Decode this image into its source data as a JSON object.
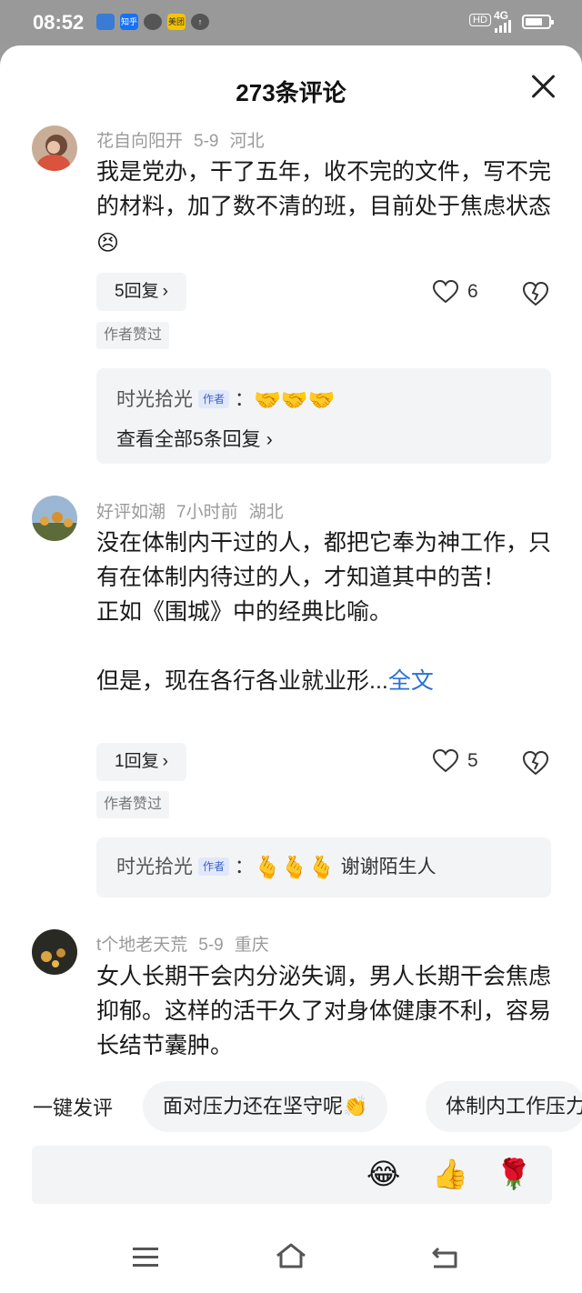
{
  "status_bar": {
    "time": "08:52",
    "apps": [
      {
        "label": "",
        "color": "#3a7bd5",
        "icon": "app-icon-1"
      },
      {
        "label": "知乎",
        "color": "#1772f6",
        "icon": "zhihu-icon"
      },
      {
        "label": "",
        "color": "#555555",
        "icon": "app-icon-3"
      },
      {
        "label": "美团",
        "color": "#f5c400",
        "icon": "meituan-icon"
      },
      {
        "label": "↑",
        "color": "#555555",
        "icon": "upload-icon"
      }
    ],
    "hd": "HD",
    "network": "4G"
  },
  "sheet": {
    "title": "273条评论"
  },
  "comments": [
    {
      "user": "花自向阳开",
      "date": "5-9",
      "region": "河北",
      "text": "我是党办，干了五年，收不完的文件，写不完的材料，加了数不清的班，目前处于焦虑状态",
      "text_emoji": "😣",
      "reply_label": "5回复",
      "likes": "6",
      "tag": "作者赞过",
      "sub_reply": {
        "name": "时光拾光",
        "badge": "作者",
        "sep": "：",
        "content": "🤝🤝🤝"
      },
      "view_all": "查看全部5条回复"
    },
    {
      "user": "好评如潮",
      "date": "7小时前",
      "region": "湖北",
      "text": "没在体制内干过的人，都把它奉为神工作，只有在体制内待过的人，才知道其中的苦！\n正如《围城》中的经典比喻。\n\n但是，现在各行各业就业形...",
      "full_link": "全文",
      "reply_label": "1回复",
      "likes": "5",
      "tag": "作者赞过",
      "sub_reply": {
        "name": "时光拾光",
        "badge": "作者",
        "sep": "：",
        "content": "🫰🫰🫰",
        "suffix": "谢谢陌生人"
      }
    },
    {
      "user": "t个地老天荒",
      "date": "5-9",
      "region": "重庆",
      "text": "女人长期干会内分泌失调，男人长期干会焦虑抑郁。这样的活干久了对身体健康不利，容易长结节囊肿。"
    }
  ],
  "quick": {
    "label": "一键发评",
    "pills": [
      "面对压力还在坚守呢👏",
      "体制内工作压力"
    ]
  },
  "input_bar": {
    "emojis": [
      "😂",
      "👍",
      "🌹"
    ]
  },
  "colors": {
    "link": "#2a6fd6",
    "pill_bg": "#f3f4f6",
    "meta_gray": "#9a9a9a"
  }
}
